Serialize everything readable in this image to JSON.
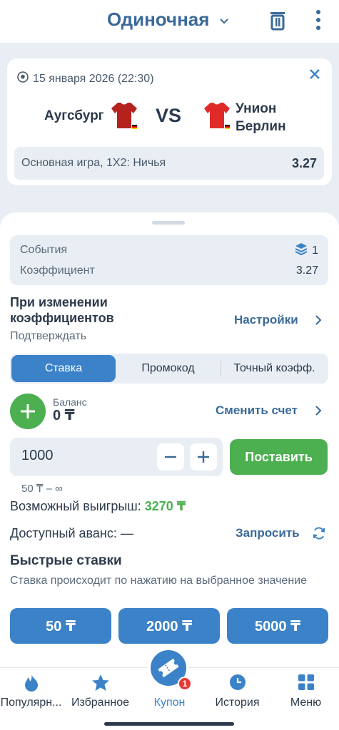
{
  "header": {
    "title": "Одиночная"
  },
  "event": {
    "date": "15 января 2026 (22:30)",
    "team_home": "Аугсбург",
    "vs": "VS",
    "team_away_line1": "Унион",
    "team_away_line2": "Берлин",
    "market_label": "Основная игра, 1X2: Ничья",
    "odd": "3.27",
    "jersey_home_color": "#b5221e",
    "jersey_away_color": "#e02a2a"
  },
  "summary": {
    "events_label": "События",
    "events_count": "1",
    "coef_label": "Коэффициент",
    "coef_value": "3.27"
  },
  "odds_change": {
    "title": "При изменении коэффициентов",
    "subtitle": "Подтверждать",
    "settings_label": "Настройки"
  },
  "tabs": [
    {
      "label": "Ставка",
      "active": true
    },
    {
      "label": "Промокод",
      "active": false
    },
    {
      "label": "Точный коэфф.",
      "active": false
    }
  ],
  "balance": {
    "label": "Баланс",
    "value": "0 ₸",
    "change_account": "Сменить счет"
  },
  "stake": {
    "amount": "1000",
    "minus": "−",
    "plus": "+",
    "place_label": "Поставить",
    "limits": "50 ₸ – ∞"
  },
  "possible_win": {
    "label": "Возможный выигрыш:",
    "value": "3270 ₸"
  },
  "advance": {
    "label": "Доступный аванс:",
    "value": "—",
    "request_label": "Запросить"
  },
  "quick_bets": {
    "title": "Быстрые ставки",
    "description": "Ставка происходит по нажатию на выбранное значение",
    "amounts": [
      "50 ₸",
      "2000 ₸",
      "5000 ₸"
    ]
  },
  "bottom_nav": {
    "items": [
      {
        "label": "Популярн...",
        "icon": "fire-icon"
      },
      {
        "label": "Избранное",
        "icon": "star-icon"
      },
      {
        "label": "Купон",
        "icon": "ticket-icon"
      },
      {
        "label": "История",
        "icon": "clock-icon"
      },
      {
        "label": "Меню",
        "icon": "grid-icon"
      }
    ],
    "coupon_badge": "1"
  },
  "colors": {
    "accent": "#3b82c8",
    "primary_text": "#3a6a99",
    "green": "#4caf50",
    "badge": "#e53935"
  }
}
